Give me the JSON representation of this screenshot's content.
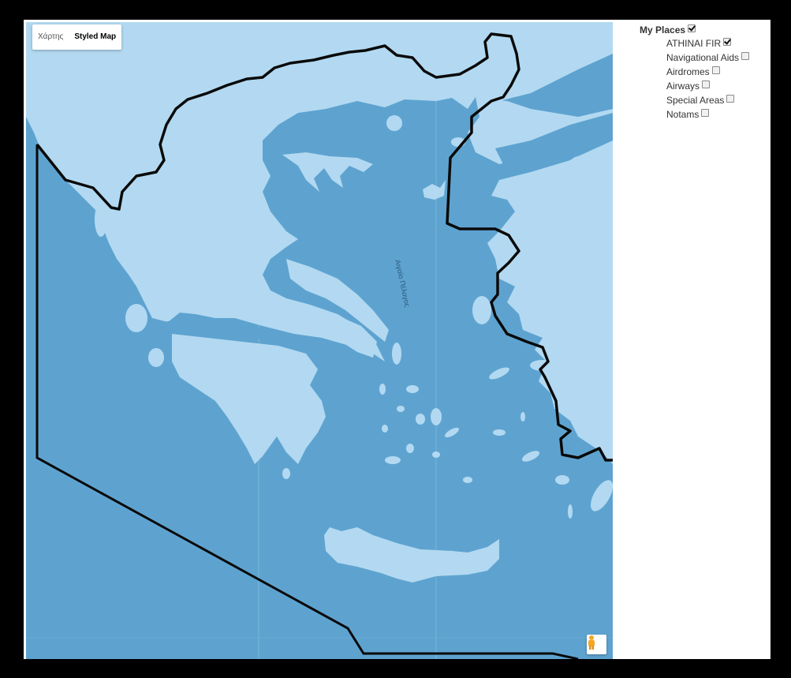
{
  "map": {
    "type_control": {
      "options": [
        "Χάρτης",
        "Styled Map"
      ],
      "active": "Styled Map"
    },
    "sea_label": "Αιγαίο Πέλαγος",
    "pegman_icon": "street-view-pegman-icon",
    "colors": {
      "sea": "#5ea3d0",
      "land": "#b2d9f1",
      "fir_boundary": "#0a0a0a"
    }
  },
  "panel": {
    "root": {
      "label": "My Places",
      "checked": true
    },
    "items": [
      {
        "label": "ATHINAI FIR",
        "checked": true
      },
      {
        "label": "Navigational Aids",
        "checked": false
      },
      {
        "label": "Airdromes",
        "checked": false
      },
      {
        "label": "Airways",
        "checked": false
      },
      {
        "label": "Special Areas",
        "checked": false
      },
      {
        "label": "Notams",
        "checked": false
      }
    ]
  }
}
